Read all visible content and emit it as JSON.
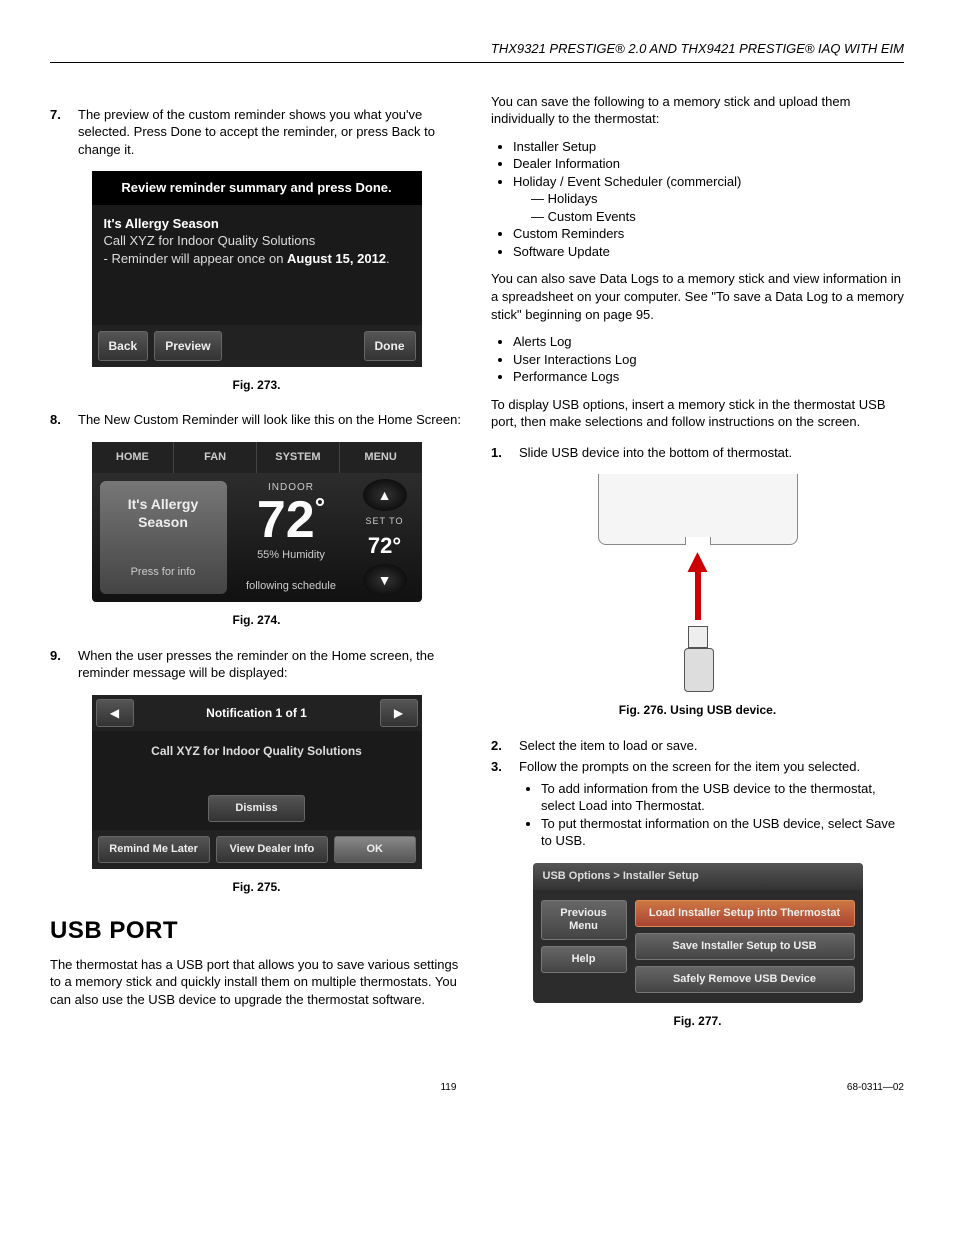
{
  "header": {
    "line": "THX9321 PRESTIGE® 2.0 AND THX9421 PRESTIGE® IAQ WITH EIM"
  },
  "left": {
    "step7": "The preview of the custom reminder shows you what you've selected. Press Done to accept the reminder, or press Back to change it.",
    "fig273": {
      "title": "Review reminder summary and press Done.",
      "heading": "It's Allergy Season",
      "line1": "Call XYZ for Indoor Quality Solutions",
      "line2_pre": "- Reminder will appear once on ",
      "line2_bold": "August 15, 2012",
      "btn_back": "Back",
      "btn_preview": "Preview",
      "btn_done": "Done",
      "caption": "Fig. 273."
    },
    "step8": "The New Custom Reminder will look like this on the Home Screen:",
    "fig274": {
      "tabs": {
        "home": "HOME",
        "fan": "FAN",
        "system": "SYSTEM",
        "menu": "MENU"
      },
      "alert_title": "It's Allergy Season",
      "alert_info": "Press for info",
      "indoor": "INDOOR",
      "temp": "72",
      "deg": "°",
      "humidity": "55% Humidity",
      "schedule": "following schedule",
      "setto": "SET TO",
      "settemp": "72°",
      "caption": "Fig. 274."
    },
    "step9": "When the user presses the reminder on the Home screen, the reminder message will be displayed:",
    "fig275": {
      "title": "Notification 1 of 1",
      "msg": "Call XYZ for Indoor Quality Solutions",
      "dismiss": "Dismiss",
      "remind": "Remind Me Later",
      "dealer": "View Dealer Info",
      "ok": "OK",
      "caption": "Fig. 275."
    },
    "usb_heading": "USB PORT",
    "usb_para": "The thermostat has a USB port that allows you to save various settings to a memory stick and quickly install them on multiple thermostats. You can also use the USB device to upgrade the thermostat software."
  },
  "right": {
    "save_intro": "You can save the following to a memory stick and upload them individually to the thermostat:",
    "save_list": {
      "a": "Installer Setup",
      "b": "Dealer Information",
      "c": "Holiday / Event Scheduler (commercial)",
      "c1": "Holidays",
      "c2": "Custom Events",
      "d": "Custom Reminders",
      "e": "Software Update"
    },
    "datalog_para": "You can also save Data Logs to a memory stick and view information in a spreadsheet on your computer. See \"To save a Data Log to a memory stick\" beginning on page 95.",
    "log_list": {
      "a": "Alerts Log",
      "b": "User Interactions Log",
      "c": "Performance Logs"
    },
    "display_para": "To display USB options, insert a memory stick in the thermostat USB port, then make selections and follow instructions on the screen.",
    "step1": "Slide USB device into the bottom of thermostat.",
    "fig276_caption": "Fig. 276. Using USB device.",
    "step2": "Select the item to load or save.",
    "step3": "Follow the prompts on the screen for the item you selected.",
    "step3a": "To add information from the USB device to the thermostat, select Load into Thermostat.",
    "step3b": "To put thermostat information on the USB device, select Save to USB.",
    "fig277": {
      "crumb": "USB Options > Installer Setup",
      "prev": "Previous Menu",
      "help": "Help",
      "load": "Load Installer Setup into Thermostat",
      "save": "Save Installer Setup to USB",
      "remove": "Safely Remove USB Device",
      "caption": "Fig. 277."
    }
  },
  "footer": {
    "page": "119",
    "doc": "68-0311—02"
  }
}
